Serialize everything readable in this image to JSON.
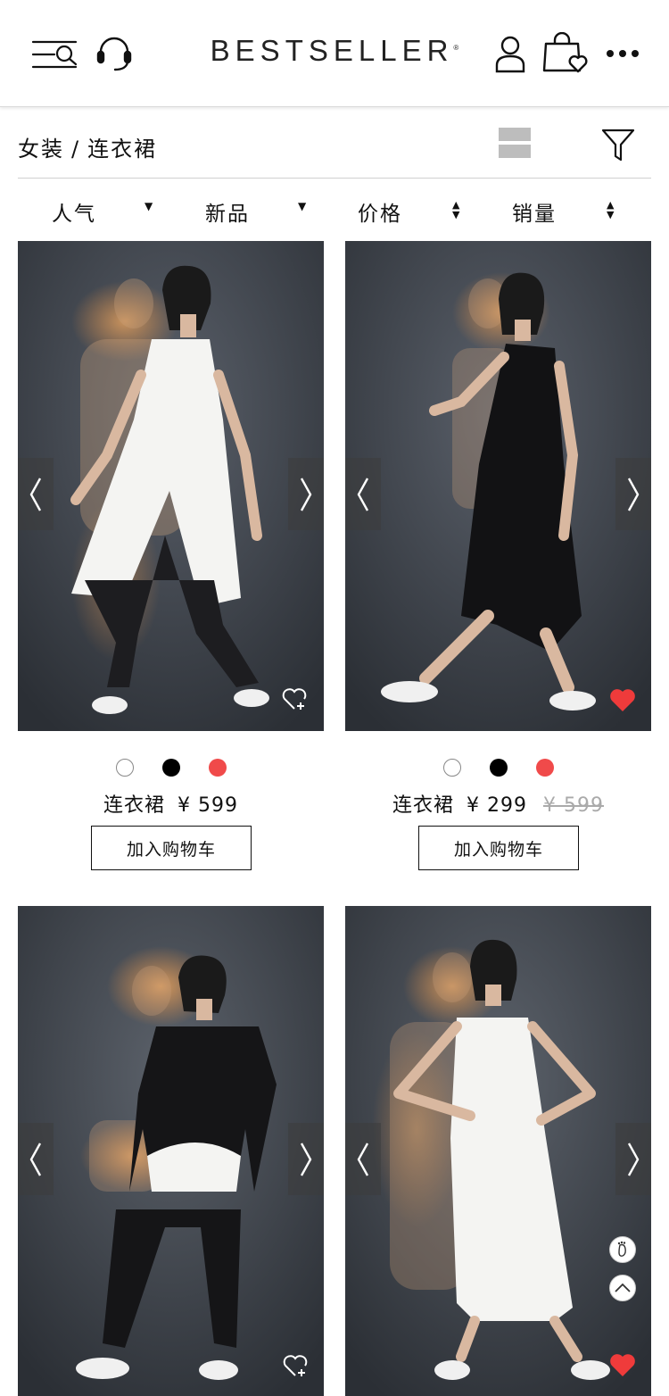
{
  "header": {
    "logo": "BESTSELLER",
    "logo_mark": "®",
    "icons": [
      "menu-search-icon",
      "headset-icon",
      "user-icon",
      "shopping-bag-heart-icon",
      "more-icon"
    ]
  },
  "breadcrumb": {
    "category": "女装",
    "separator": "/",
    "subcategory": "连衣裙"
  },
  "sort": [
    {
      "label": "人气",
      "indicator": "▼"
    },
    {
      "label": "新品",
      "indicator": "▼"
    },
    {
      "label": "价格",
      "indicator": "▲▼"
    },
    {
      "label": "销量",
      "indicator": "▲▼"
    }
  ],
  "colors": {
    "swatch_white": "#ffffff",
    "swatch_black": "#000000",
    "swatch_red": "#f04a4a",
    "heart_red": "#ef3b3b",
    "photo_bg": "#3a3f46"
  },
  "products": [
    {
      "name": "连衣裙",
      "price": "¥ 599",
      "old_price": "",
      "cart_label": "加入购物车",
      "favorited": false,
      "outfit": "white-tunic"
    },
    {
      "name": "连衣裙",
      "price": "¥ 299",
      "old_price": "¥ 599",
      "cart_label": "加入购物车",
      "favorited": true,
      "outfit": "black-dress"
    },
    {
      "name": "",
      "price": "",
      "old_price": "",
      "cart_label": "",
      "favorited": false,
      "outfit": "black-shirt"
    },
    {
      "name": "",
      "price": "",
      "old_price": "",
      "cart_label": "",
      "favorited": true,
      "outfit": "white-dress"
    }
  ],
  "floating": [
    "footprint-icon",
    "back-to-top-icon"
  ]
}
